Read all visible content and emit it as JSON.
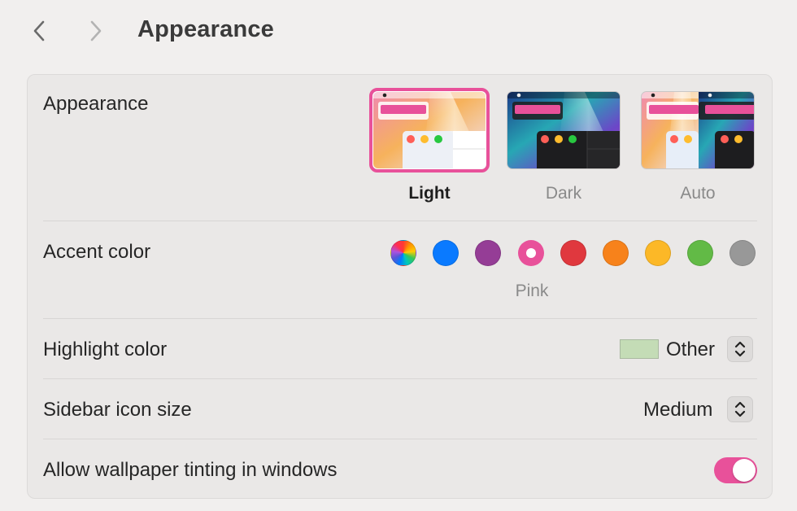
{
  "header": {
    "title": "Appearance"
  },
  "appearance": {
    "label": "Appearance",
    "options": [
      {
        "label": "Light",
        "selected": true
      },
      {
        "label": "Dark",
        "selected": false
      },
      {
        "label": "Auto",
        "selected": false
      }
    ]
  },
  "accent": {
    "label": "Accent color",
    "selected_name": "Pink",
    "colors": [
      {
        "name": "Multicolor",
        "color": "conic"
      },
      {
        "name": "Blue",
        "color": "#0a7aff"
      },
      {
        "name": "Purple",
        "color": "#953d96"
      },
      {
        "name": "Pink",
        "color": "#e8519a"
      },
      {
        "name": "Red",
        "color": "#e0383e"
      },
      {
        "name": "Orange",
        "color": "#f7821b"
      },
      {
        "name": "Yellow",
        "color": "#fcb827"
      },
      {
        "name": "Green",
        "color": "#62ba46"
      },
      {
        "name": "Graphite",
        "color": "#989898"
      }
    ]
  },
  "highlight": {
    "label": "Highlight color",
    "value": "Other",
    "swatch_color": "#c4dcb6"
  },
  "sidebar": {
    "label": "Sidebar icon size",
    "value": "Medium"
  },
  "tinting": {
    "label": "Allow wallpaper tinting in windows",
    "enabled": true
  }
}
